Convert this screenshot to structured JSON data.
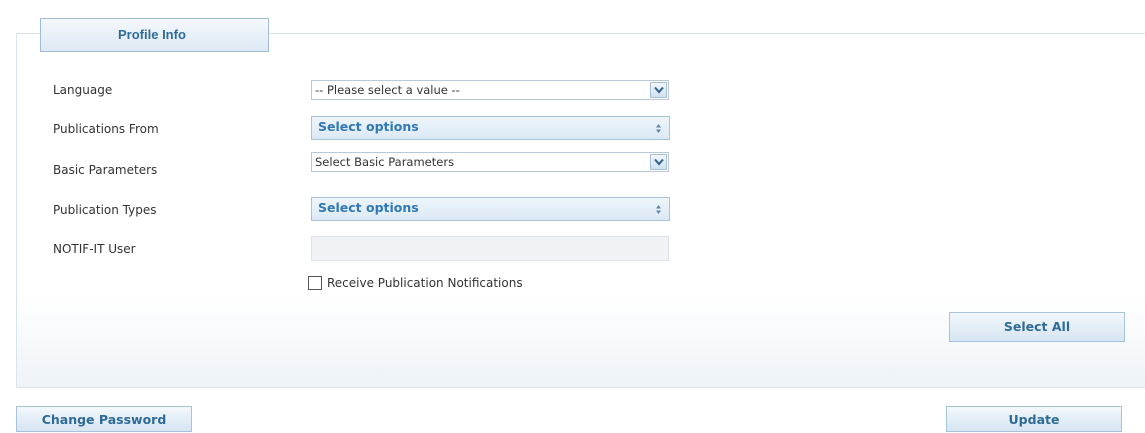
{
  "panel": {
    "tab_label": "Profile Info"
  },
  "form": {
    "language": {
      "label": "Language",
      "value": "-- Please select a value --"
    },
    "publications_from": {
      "label": "Publications From",
      "value": "Select options"
    },
    "basic_parameters": {
      "label": "Basic Parameters",
      "value": "Select Basic Parameters"
    },
    "publication_types": {
      "label": "Publication Types",
      "value": "Select options"
    },
    "notifit_user": {
      "label": "NOTIF-IT User",
      "value": ""
    },
    "receive_notifications": {
      "label": "Receive Publication Notifications",
      "checked": false
    }
  },
  "buttons": {
    "select_all": "Select All",
    "change_password": "Change Password",
    "update": "Update"
  },
  "colors": {
    "accent": "#2e6b97",
    "link_blue": "#2f78b3",
    "border": "#a8c4dc"
  },
  "icons": {
    "dropdown": "chevron-down-icon",
    "multiselect": "updown-arrows-icon"
  }
}
